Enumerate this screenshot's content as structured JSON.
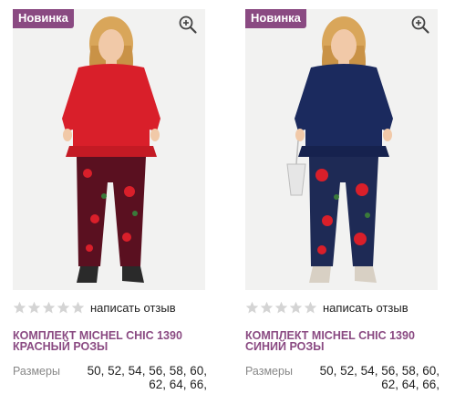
{
  "products": [
    {
      "badge": "Новинка",
      "review_link": "написать отзыв",
      "title_line1": "КОМПЛЕКТ MICHEL CHIC 1390",
      "title_line2": "КРАСНЫЙ РОЗЫ",
      "sizes_label": "Размеры",
      "sizes_line1": "50, 52, 54, 56, 58, 60,",
      "sizes_line2": "62, 64, 66,",
      "top_color": "#d91f2a",
      "pants_color": "#5a1020"
    },
    {
      "badge": "Новинка",
      "review_link": "написать отзыв",
      "title_line1": "КОМПЛЕКТ MICHEL CHIC 1390",
      "title_line2": "СИНИЙ РОЗЫ",
      "sizes_label": "Размеры",
      "sizes_line1": "50, 52, 54, 56, 58, 60,",
      "sizes_line2": "62, 64, 66,",
      "top_color": "#1b2a5e",
      "pants_color": "#1e2a55"
    }
  ],
  "colors": {
    "accent": "#8a4a82",
    "star_empty": "#d4d4d4"
  },
  "icons": {
    "zoom": "zoom-icon",
    "star": "star-icon"
  }
}
